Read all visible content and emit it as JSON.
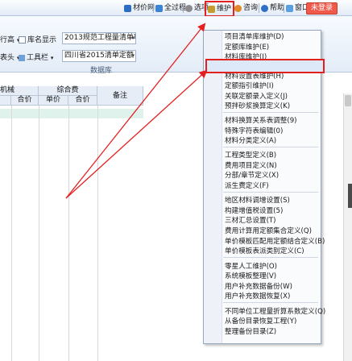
{
  "menubar": {
    "material_net": "材价网",
    "all_process": "全过程",
    "options": "选项",
    "maintenance": "维护",
    "consult": "咨询",
    "help": "帮助",
    "window": "窗口",
    "login": "未登录"
  },
  "ribbon": {
    "row_height_label": "行高",
    "library_display_label": "库名显示",
    "header_label": "表头",
    "toolbar_label": "工具栏",
    "standard_combo": "2013规范工程量清单项目",
    "quota_combo": "四川省2015清单定额",
    "group_label": "数据库"
  },
  "grid": {
    "left_header": "机械",
    "col_composite": "综合费",
    "col_unit_price": "单价",
    "col_total_price": "合价",
    "col_total_price_left": "合价",
    "col_remark": "备注"
  },
  "context_menu": {
    "items": [
      "项目清单库维护(D)",
      "定额库维护(E)",
      "材料库维护(I)",
      "材料价格表维护(G)",
      "材料设置表维护(H)",
      "定额指引维护(I)",
      "关联定额录入定义(J)",
      "预拌砂浆换算定义(K)",
      "材料换算关系表调整(9)",
      "特殊字符表编辑(0)",
      "材料分类定义(A)",
      "工程类型定义(B)",
      "费用项目定义(N)",
      "分部/章节定义(X)",
      "派生费定义(F)",
      "地区材料调增设置(S)",
      "构建增值税设置(5)",
      "三材汇总设置(T)",
      "费用计算用定额集合定义(Q)",
      "单价模板匹配用定额结合定义(B)",
      "单价模板表派类别定义(C)",
      "零星人工维护(O)",
      "系统模板整理(V)",
      "用户补充数据备份(W)",
      "用户补充数据恢复(X)",
      "不同单位工程量折算系数定义(Q)",
      "从备份目录恢复工程(Y)",
      "整理备份目录(Z)"
    ],
    "highlighted_index": 3
  },
  "colors": {
    "highlight_border": "#e3201f",
    "arrow": "#e3201f",
    "menubar_bg": "#e2ebf7"
  }
}
